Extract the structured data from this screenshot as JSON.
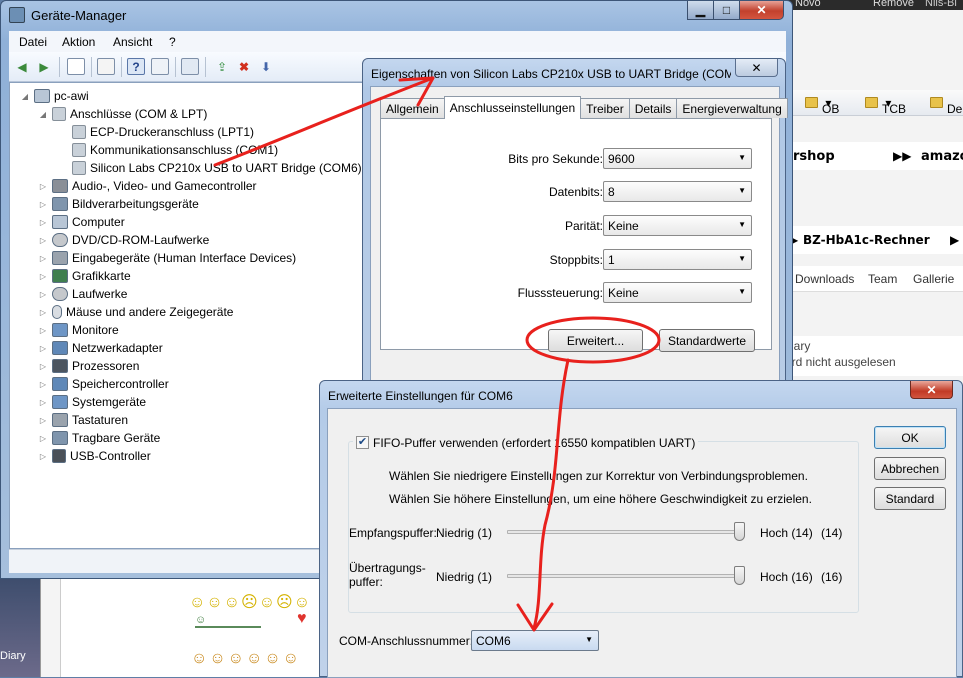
{
  "background": {
    "top_labels": [
      "Novo",
      "Remove",
      "Nils-Bi"
    ],
    "toolbar_items": [
      "OB",
      "TCB",
      "De"
    ],
    "banner1": "rshop",
    "banner1_right": "amazo",
    "banner2": "BZ-HbA1c-Rechner",
    "nav": [
      "Downloads",
      "Team",
      "Gallerie"
    ],
    "list_lines": [
      "iary",
      "ird nicht ausgelesen"
    ],
    "desk_left_label": "Diary"
  },
  "device_manager": {
    "title": "Geräte-Manager",
    "menu": [
      "Datei",
      "Aktion",
      "Ansicht",
      "?"
    ],
    "tree": [
      {
        "label": "pc-awi",
        "level": 0,
        "icon": "computer-icon",
        "expanded": true
      },
      {
        "label": "Anschlüsse (COM & LPT)",
        "level": 1,
        "icon": "port-icon",
        "expanded": true
      },
      {
        "label": "ECP-Druckeranschluss (LPT1)",
        "level": 2,
        "icon": "port-icon"
      },
      {
        "label": "Kommunikationsanschluss (COM1)",
        "level": 2,
        "icon": "port-icon"
      },
      {
        "label": "Silicon Labs CP210x USB to UART Bridge (COM6)",
        "level": 2,
        "icon": "port-icon"
      },
      {
        "label": "Audio-, Video- und Gamecontroller",
        "level": 1,
        "icon": "audio-icon"
      },
      {
        "label": "Bildverarbeitungsgeräte",
        "level": 1,
        "icon": "camera-icon"
      },
      {
        "label": "Computer",
        "level": 1,
        "icon": "computer-icon"
      },
      {
        "label": "DVD/CD-ROM-Laufwerke",
        "level": 1,
        "icon": "dvd-icon"
      },
      {
        "label": "Eingabegeräte (Human Interface Devices)",
        "level": 1,
        "icon": "hid-icon"
      },
      {
        "label": "Grafikkarte",
        "level": 1,
        "icon": "graphics-card-icon"
      },
      {
        "label": "Laufwerke",
        "level": 1,
        "icon": "drive-icon"
      },
      {
        "label": "Mäuse und andere Zeigegeräte",
        "level": 1,
        "icon": "mouse-icon"
      },
      {
        "label": "Monitore",
        "level": 1,
        "icon": "monitor-icon"
      },
      {
        "label": "Netzwerkadapter",
        "level": 1,
        "icon": "network-icon"
      },
      {
        "label": "Prozessoren",
        "level": 1,
        "icon": "cpu-icon"
      },
      {
        "label": "Speichercontroller",
        "level": 1,
        "icon": "storage-icon"
      },
      {
        "label": "Systemgeräte",
        "level": 1,
        "icon": "system-icon"
      },
      {
        "label": "Tastaturen",
        "level": 1,
        "icon": "keyboard-icon"
      },
      {
        "label": "Tragbare Geräte",
        "level": 1,
        "icon": "portable-icon"
      },
      {
        "label": "USB-Controller",
        "level": 1,
        "icon": "usb-icon"
      }
    ]
  },
  "properties": {
    "title": "Eigenschaften von Silicon Labs CP210x USB to UART Bridge (COM...",
    "tabs": [
      "Allgemein",
      "Anschlusseinstellungen",
      "Treiber",
      "Details",
      "Energieverwaltung"
    ],
    "active_tab": "Anschlusseinstellungen",
    "fields": [
      {
        "label": "Bits pro Sekunde:",
        "value": "9600"
      },
      {
        "label": "Datenbits:",
        "value": "8"
      },
      {
        "label": "Parität:",
        "value": "Keine"
      },
      {
        "label": "Stoppbits:",
        "value": "1"
      },
      {
        "label": "Flusssteuerung:",
        "value": "Keine"
      }
    ],
    "advanced_button": "Erweitert...",
    "defaults_button": "Standardwerte"
  },
  "advanced": {
    "title": "Erweiterte Einstellungen für COM6",
    "fifo_label": "FIFO-Puffer verwenden (erfordert 16550 kompatiblen UART)",
    "fifo_checked": true,
    "hint1": "Wählen Sie niedrigere Einstellungen zur Korrektur von Verbindungsproblemen.",
    "hint2": "Wählen Sie höhere Einstellungen, um eine höhere Geschwindigkeit zu erzielen.",
    "receive": {
      "label": "Empfangspuffer:",
      "low": "Niedrig (1)",
      "high": "Hoch (14)",
      "value": "(14)",
      "level": 1.0
    },
    "transmit": {
      "label1": "Übertragungs-",
      "label2": "puffer:",
      "low": "Niedrig (1)",
      "high": "Hoch (16)",
      "value": "(16)",
      "level": 1.0
    },
    "com_label": "COM-Anschlussnummer:",
    "com_value": "COM6",
    "ok": "OK",
    "cancel": "Abbrechen",
    "default": "Standard"
  },
  "colors": {
    "annotation": "#e8211d",
    "accent": "#3d5678"
  }
}
